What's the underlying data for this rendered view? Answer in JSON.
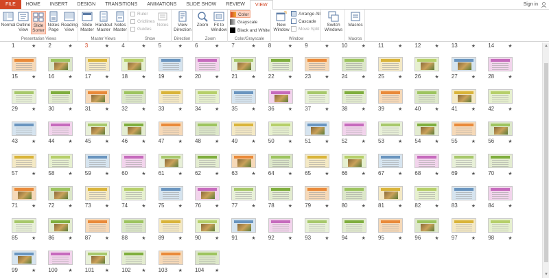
{
  "tabs": [
    {
      "label": "FILE",
      "kind": "file"
    },
    {
      "label": "HOME"
    },
    {
      "label": "INSERT"
    },
    {
      "label": "DESIGN"
    },
    {
      "label": "TRANSITIONS"
    },
    {
      "label": "ANIMATIONS"
    },
    {
      "label": "SLIDE SHOW"
    },
    {
      "label": "REVIEW"
    },
    {
      "label": "VIEW",
      "kind": "active"
    }
  ],
  "signin": "Sign in",
  "ribbon": {
    "presentation_views": {
      "label": "Presentation Views",
      "normal": "Normal",
      "outline": "Outline View",
      "slide_sorter": "Slide Sorter",
      "notes_page": "Notes Page",
      "reading_view": "Reading View"
    },
    "master_views": {
      "label": "Master Views",
      "slide_master": "Slide Master",
      "handout_master": "Handout Master",
      "notes_master": "Notes Master"
    },
    "show": {
      "label": "Show",
      "ruler": "Ruler",
      "gridlines": "Gridlines",
      "guides": "Guides"
    },
    "notes": "Notes",
    "view_direction": {
      "label": "Direction",
      "btn": "View Direction"
    },
    "zoom": {
      "label": "Zoom",
      "zoom": "Zoom",
      "fit": "Fit to Window"
    },
    "color": {
      "label": "Color/Grayscale",
      "color": "Color",
      "grayscale": "Grayscale",
      "bw": "Black and White"
    },
    "window": {
      "label": "Window",
      "new_window": "New Window",
      "arrange_all": "Arrange All",
      "cascade": "Cascade",
      "move_split": "Move Split"
    },
    "switch": {
      "btn": "Switch Windows"
    },
    "macros": {
      "label": "Macros",
      "btn": "Macros"
    }
  },
  "slides": {
    "count": 104,
    "current": 3,
    "star": "★"
  },
  "colors": {
    "accent": "#d24726",
    "selected_bg": "#fcd2c2"
  }
}
